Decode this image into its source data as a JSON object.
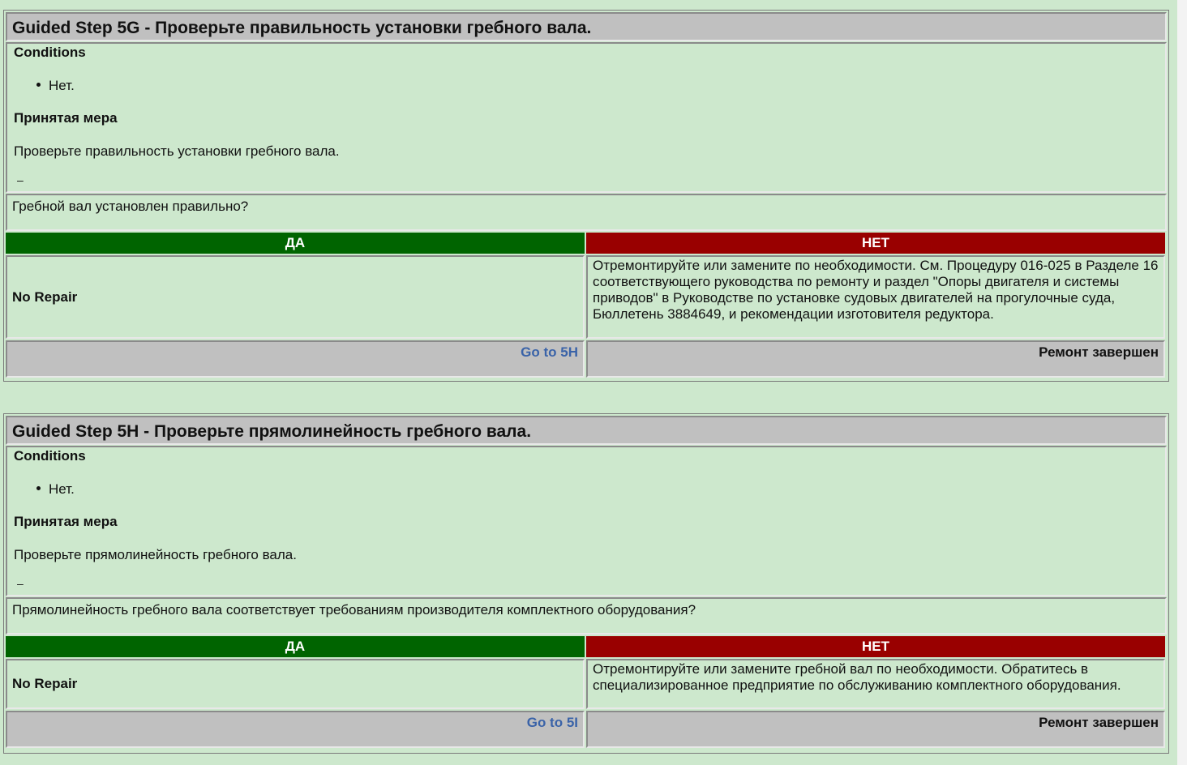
{
  "steps": [
    {
      "title": "Guided Step 5G - Проверьте правильность установки гребного вала.",
      "conditions_label": "Conditions",
      "conditions": [
        "Нет."
      ],
      "action_label": "Принятая мера",
      "action_text": "Проверьте правильность установки гребного вала.",
      "dash": "–",
      "question": "Гребной вал установлен правильно?",
      "yes_label": "ДА",
      "no_label": "НЕТ",
      "yes_result": "No Repair",
      "no_result": "Отремонтируйте или замените по необходимости. См. Процедуру 016-025 в Разделе 16 соответствующего руководства по ремонту и раздел \"Опоры двигателя и системы приводов\" в Руководстве по установке судовых двигателей на прогулочные суда, Бюллетень 3884649, и рекомендации изготовителя редуктора.",
      "yes_nav": "Go to 5H",
      "no_nav": "Ремонт завершен"
    },
    {
      "title": "Guided Step 5H - Проверьте прямолинейность гребного вала.",
      "conditions_label": "Conditions",
      "conditions": [
        "Нет."
      ],
      "action_label": "Принятая мера",
      "action_text": "Проверьте прямолинейность гребного вала.",
      "dash": "–",
      "question": "Прямолинейность гребного вала соответствует требованиям производителя комплектного оборудования?",
      "yes_label": "ДА",
      "no_label": "НЕТ",
      "yes_result": "No Repair",
      "no_result": "Отремонтируйте или замените гребной вал по необходимости. Обратитесь в специализированное предприятие по обслуживанию комплектного оборудования.",
      "yes_nav": "Go to 5I",
      "no_nav": "Ремонт завершен"
    }
  ]
}
